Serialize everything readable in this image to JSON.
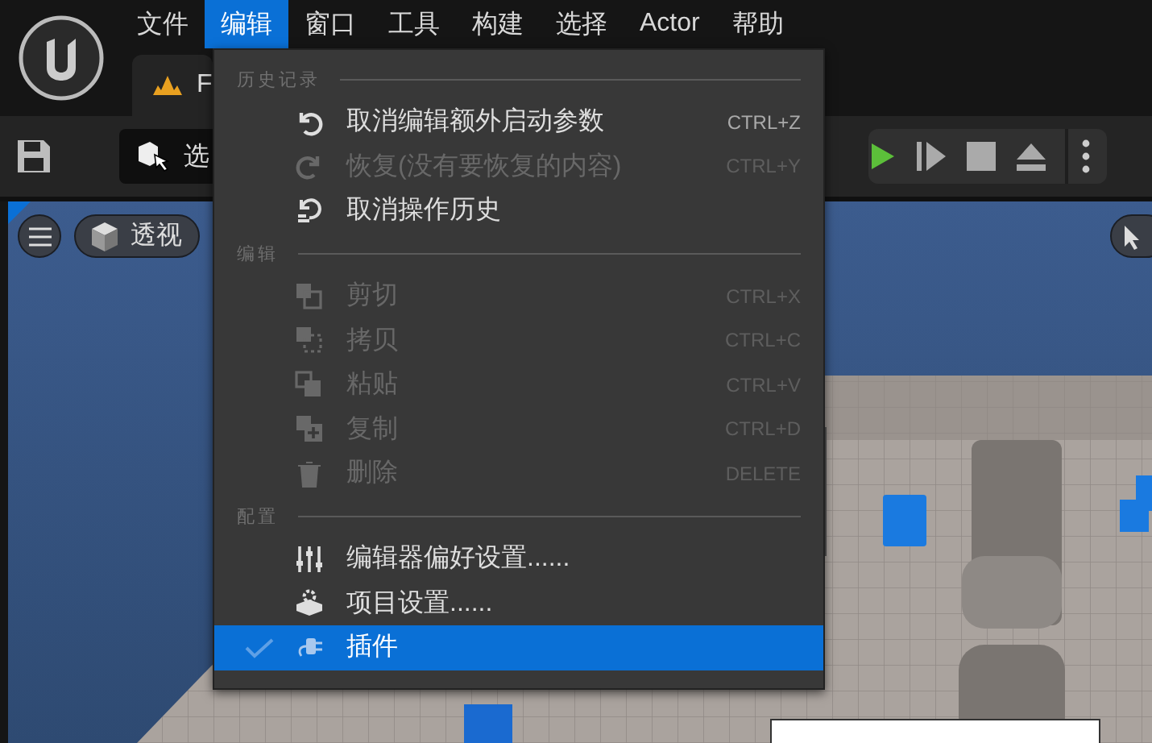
{
  "menubar": [
    {
      "label": "文件",
      "selected": false
    },
    {
      "label": "编辑",
      "selected": true
    },
    {
      "label": "窗口",
      "selected": false
    },
    {
      "label": "工具",
      "selected": false
    },
    {
      "label": "构建",
      "selected": false
    },
    {
      "label": "选择",
      "selected": false
    },
    {
      "label": "Actor",
      "selected": false
    },
    {
      "label": "帮助",
      "selected": false
    }
  ],
  "document_tab": {
    "label": "F"
  },
  "toolbar": {
    "mode_button": {
      "label": "选"
    }
  },
  "viewport": {
    "view_mode": {
      "label": "透视"
    }
  },
  "edit_menu": {
    "sections": [
      {
        "heading": "历史记录",
        "items": [
          {
            "label": "取消编辑额外启动参数",
            "shortcut": "CTRL+Z",
            "disabled": false,
            "selected": false,
            "checked": false
          },
          {
            "label": "恢复(没有要恢复的内容)",
            "shortcut": "CTRL+Y",
            "disabled": true,
            "selected": false,
            "checked": false
          },
          {
            "label": "取消操作历史",
            "disabled": false,
            "selected": false,
            "checked": false
          }
        ]
      },
      {
        "heading": "编辑",
        "items": [
          {
            "label": "剪切",
            "shortcut": "CTRL+X",
            "disabled": true,
            "selected": false,
            "checked": false
          },
          {
            "label": "拷贝",
            "shortcut": "CTRL+C",
            "disabled": true,
            "selected": false,
            "checked": false
          },
          {
            "label": "粘贴",
            "shortcut": "CTRL+V",
            "disabled": true,
            "selected": false,
            "checked": false
          },
          {
            "label": "复制",
            "shortcut": "CTRL+D",
            "disabled": true,
            "selected": false,
            "checked": false
          },
          {
            "label": "删除",
            "shortcut": "DELETE",
            "disabled": true,
            "selected": false,
            "checked": false
          }
        ]
      },
      {
        "heading": "配置",
        "items": [
          {
            "label": "编辑器偏好设置......",
            "disabled": false,
            "selected": false,
            "checked": false
          },
          {
            "label": "项目设置......",
            "disabled": false,
            "selected": false,
            "checked": false
          },
          {
            "label": "插件",
            "disabled": false,
            "selected": true,
            "checked": true
          }
        ]
      }
    ]
  }
}
